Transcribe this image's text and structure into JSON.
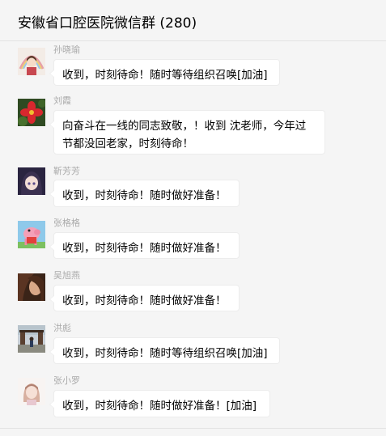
{
  "header": {
    "title": "安徽省口腔医院微信群 (280)"
  },
  "messages": [
    {
      "sender": "孙晓瑜",
      "text": "收到，时刻待命！随时等待组织召唤[加油]",
      "avatar_icon": "cartoon-girl-avatar"
    },
    {
      "sender": "刘霞",
      "text": "向奋斗在一线的同志致敬，！收到  沈老师，今年过节都没回老家，时刻待命！",
      "avatar_icon": "red-flower-avatar"
    },
    {
      "sender": "靳芳芳",
      "text": "收到，时刻待命！随时做好准备！",
      "avatar_icon": "anime-girl-avatar"
    },
    {
      "sender": "张格格",
      "text": "收到，时刻待命！随时做好准备！",
      "avatar_icon": "peppa-pig-avatar"
    },
    {
      "sender": "吴旭燕",
      "text": "收到，时刻待命！随时做好准备！",
      "avatar_icon": "woman-portrait-avatar"
    },
    {
      "sender": "洪彪",
      "text": "收到，时刻待命！随时等待组织召唤[加油]",
      "avatar_icon": "outdoor-photo-avatar"
    },
    {
      "sender": "张小罗",
      "text": "收到，时刻待命！随时做好准备！[加油]",
      "avatar_icon": "girl-photo-avatar"
    }
  ]
}
